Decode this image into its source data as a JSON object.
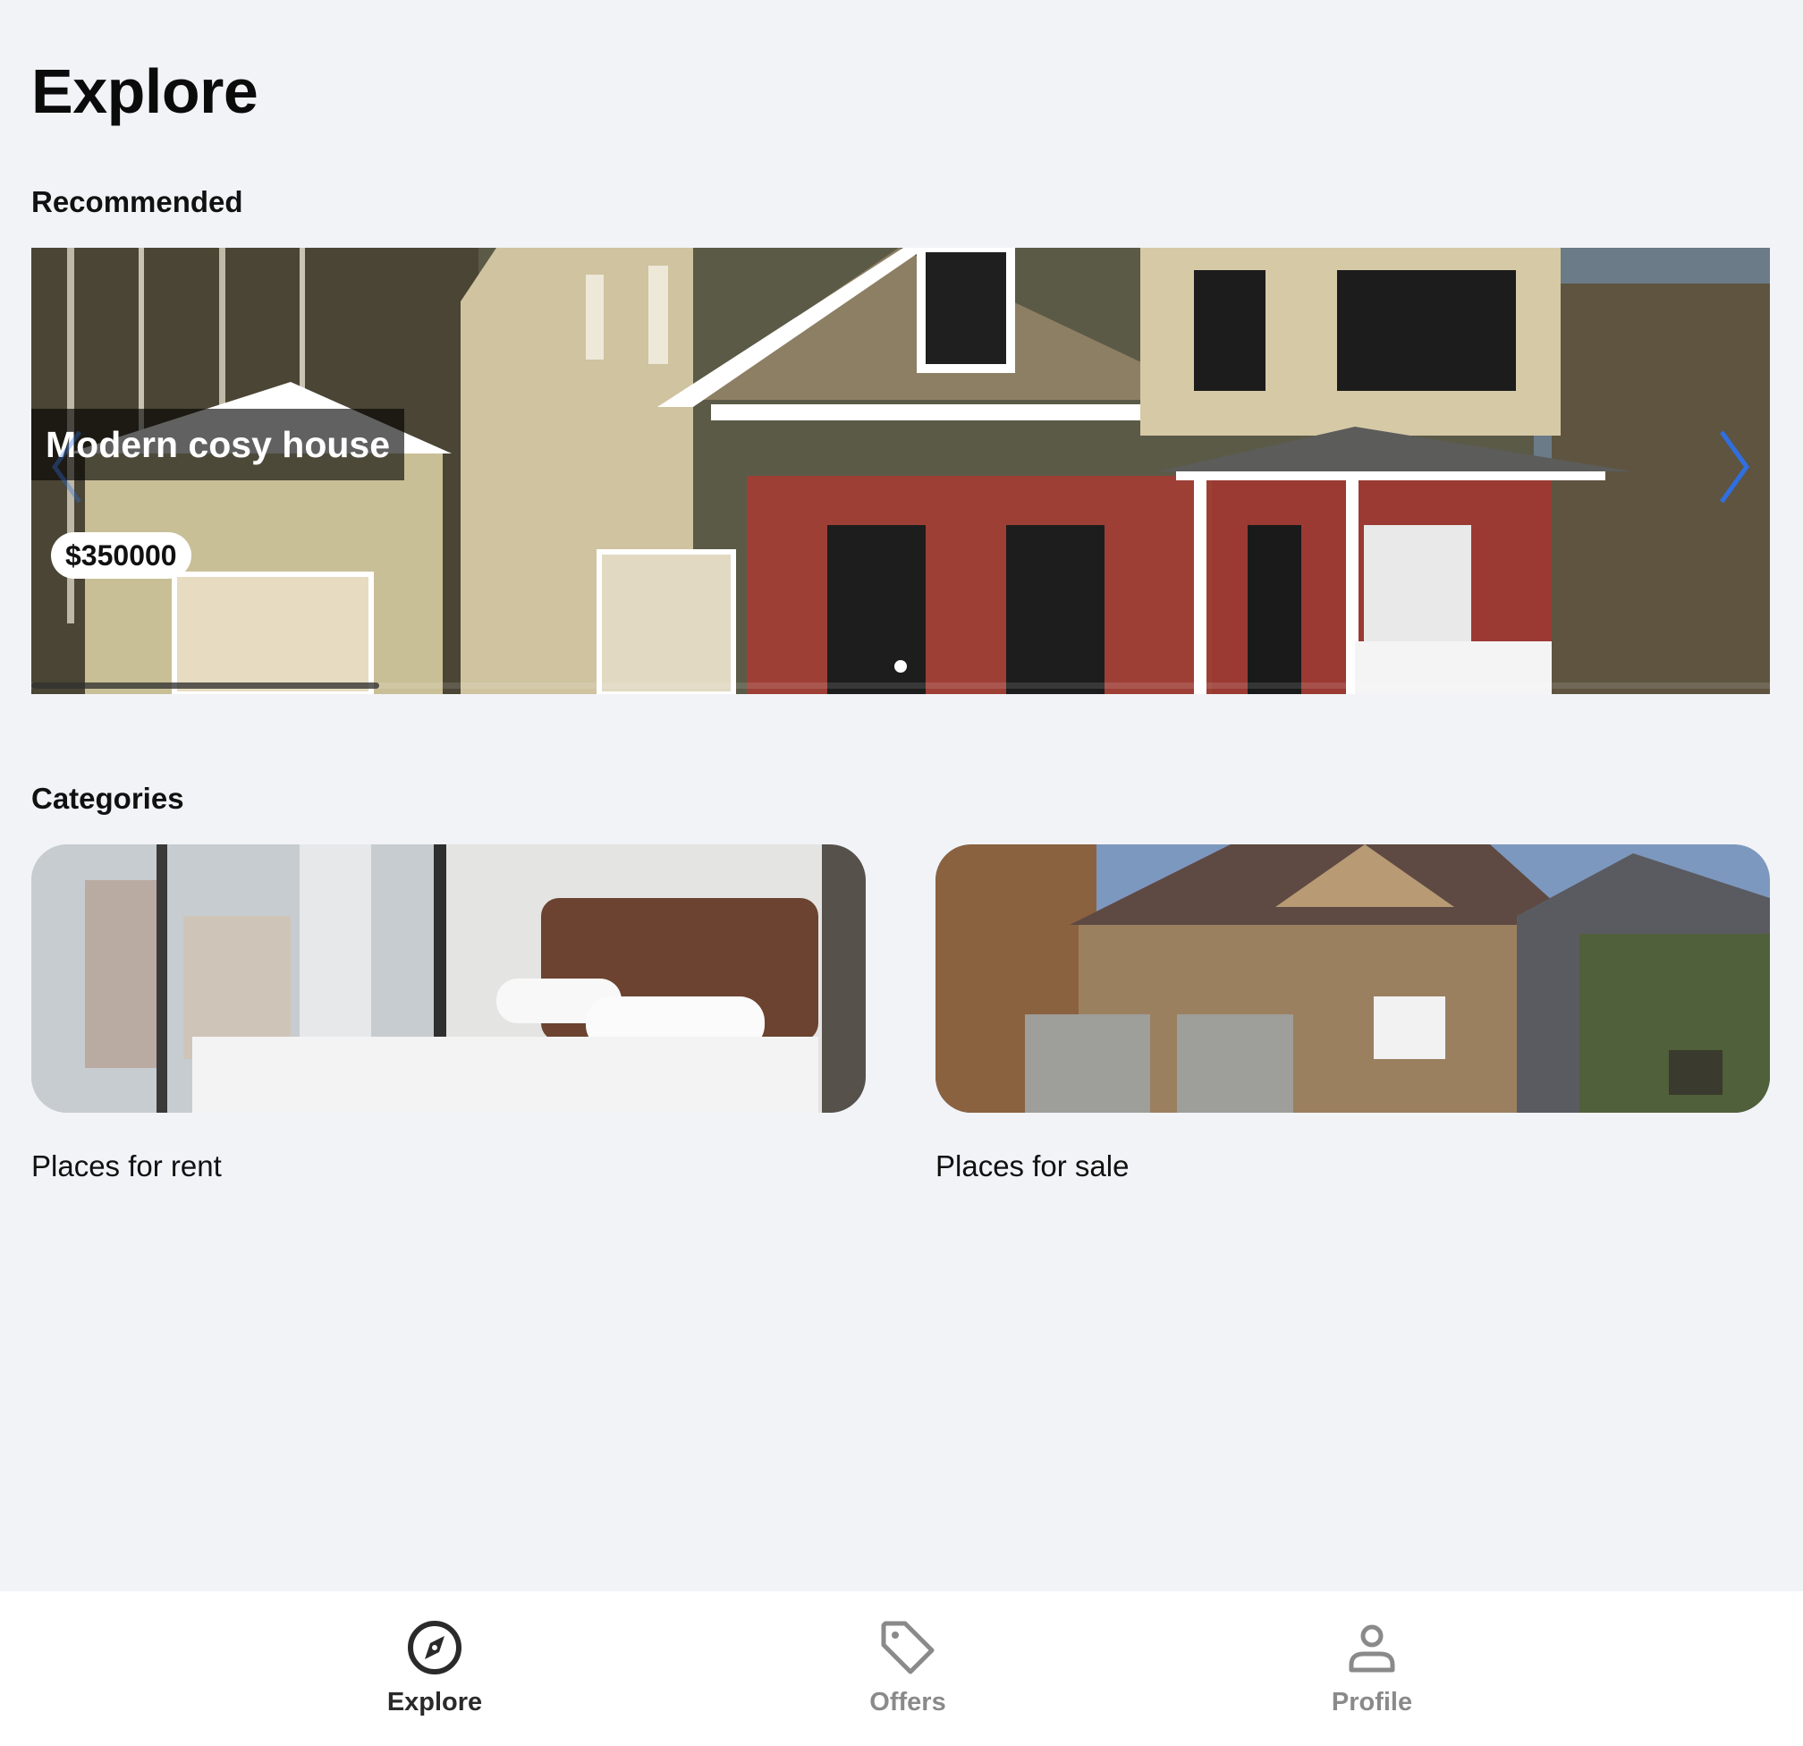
{
  "page": {
    "title": "Explore"
  },
  "recommended": {
    "heading": "Recommended",
    "slide": {
      "title": "Modern cosy house",
      "price": "$350000"
    },
    "carousel": {
      "slide_count": 1,
      "active_index": 0,
      "progress": 0.2
    }
  },
  "categories": {
    "heading": "Categories",
    "items": [
      {
        "label": "Places for rent"
      },
      {
        "label": "Places for sale"
      }
    ]
  },
  "bottom_nav": {
    "items": [
      {
        "label": "Explore",
        "icon": "compass-icon",
        "active": true
      },
      {
        "label": "Offers",
        "icon": "tag-icon",
        "active": false
      },
      {
        "label": "Profile",
        "icon": "person-icon",
        "active": false
      }
    ]
  },
  "colors": {
    "background": "#f2f3f7",
    "accent": "#2f6fe0",
    "active_nav": "#2a2a2a",
    "inactive_nav": "#8a8a8a"
  }
}
